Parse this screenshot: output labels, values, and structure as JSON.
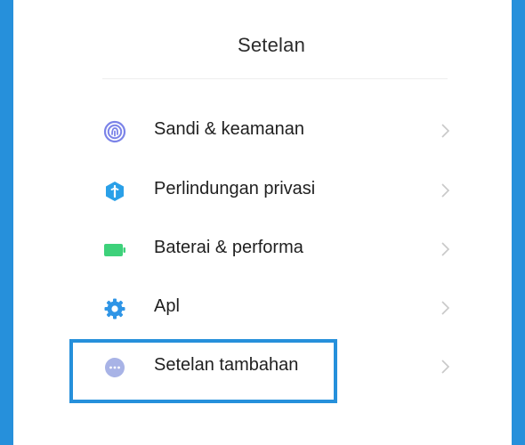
{
  "header": {
    "title": "Setelan"
  },
  "settings_items": [
    {
      "label": "Sandi & keamanan",
      "icon": "fingerprint-icon",
      "color": "#7b83e8"
    },
    {
      "label": "Perlindungan privasi",
      "icon": "shield-icon",
      "color": "#2aa0e8"
    },
    {
      "label": "Baterai & performa",
      "icon": "battery-icon",
      "color": "#3dd17a"
    },
    {
      "label": "Apl",
      "icon": "gear-icon",
      "color": "#2f95e6"
    },
    {
      "label": "Setelan tambahan",
      "icon": "more-dots-icon",
      "color": "#a8b3e6",
      "highlighted": true
    }
  ],
  "colors": {
    "frame": "#2690db",
    "highlight": "#2690db",
    "chevron": "#c8c8c8"
  }
}
